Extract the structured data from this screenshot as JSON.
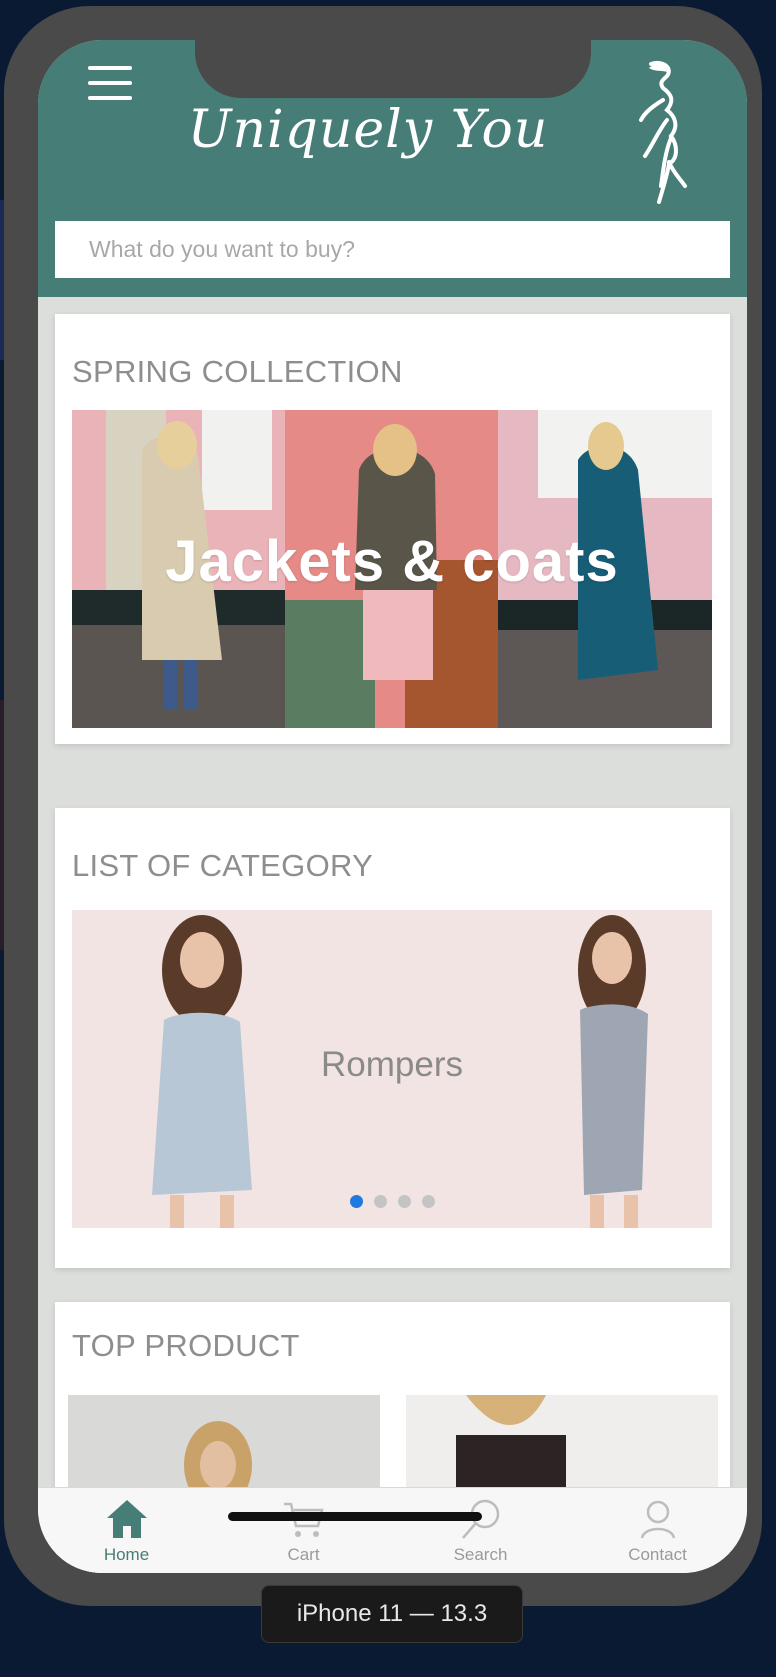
{
  "app": {
    "brand": "Uniquely You",
    "search_placeholder": "What do you want to buy?"
  },
  "sections": {
    "spring": {
      "title": "SPRING COLLECTION",
      "banner_text": "Jackets & coats"
    },
    "category": {
      "title": "LIST OF CATEGORY",
      "slide_label": "Rompers",
      "slide_count": 4,
      "active_slide": 1
    },
    "top": {
      "title": "TOP PRODUCT"
    }
  },
  "tabs": [
    {
      "label": "Home",
      "icon": "home-icon",
      "active": true
    },
    {
      "label": "Cart",
      "icon": "cart-icon",
      "active": false
    },
    {
      "label": "Search",
      "icon": "search-icon",
      "active": false
    },
    {
      "label": "Contact",
      "icon": "user-icon",
      "active": false
    }
  ],
  "device_label": "iPhone 11 — 13.3",
  "colors": {
    "brand": "#467d77",
    "active_dot": "#1f7ae0",
    "frame": "#4a4a4a"
  }
}
